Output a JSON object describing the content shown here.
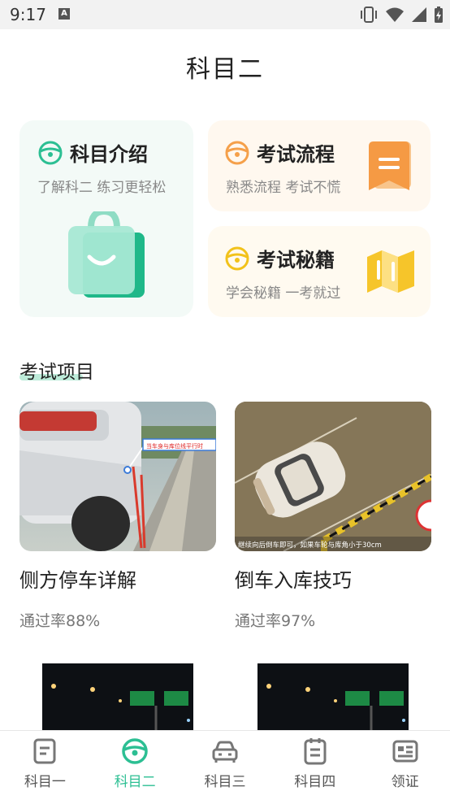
{
  "status_bar": {
    "time": "9:17",
    "notif_badge": "A"
  },
  "header": {
    "title": "科目二"
  },
  "cards": {
    "intro": {
      "title": "科目介绍",
      "subtitle": "了解科二 练习更轻松"
    },
    "flow": {
      "title": "考试流程",
      "subtitle": "熟悉流程 考试不慌"
    },
    "tips": {
      "title": "考试秘籍",
      "subtitle": "学会秘籍 一考就过"
    }
  },
  "section": {
    "title": "考试项目"
  },
  "items": [
    {
      "name": "侧方停车详解",
      "rate": "通过率88%",
      "overlay_text": "当车身与库位线平行时"
    },
    {
      "name": "倒车入库技巧",
      "rate": "通过率97%",
      "overlay_text": "继续向后倒车即可，如果车轮与库角小于30cm"
    }
  ],
  "nav": [
    {
      "label": "科目一",
      "icon": "doc-icon"
    },
    {
      "label": "科目二",
      "icon": "steering-wheel-icon"
    },
    {
      "label": "科目三",
      "icon": "car-icon"
    },
    {
      "label": "科目四",
      "icon": "notebook-icon"
    },
    {
      "label": "领证",
      "icon": "id-card-icon"
    }
  ],
  "colors": {
    "accent": "#2cbf93",
    "orange": "#f5a04a",
    "yellow": "#f2c21b"
  }
}
